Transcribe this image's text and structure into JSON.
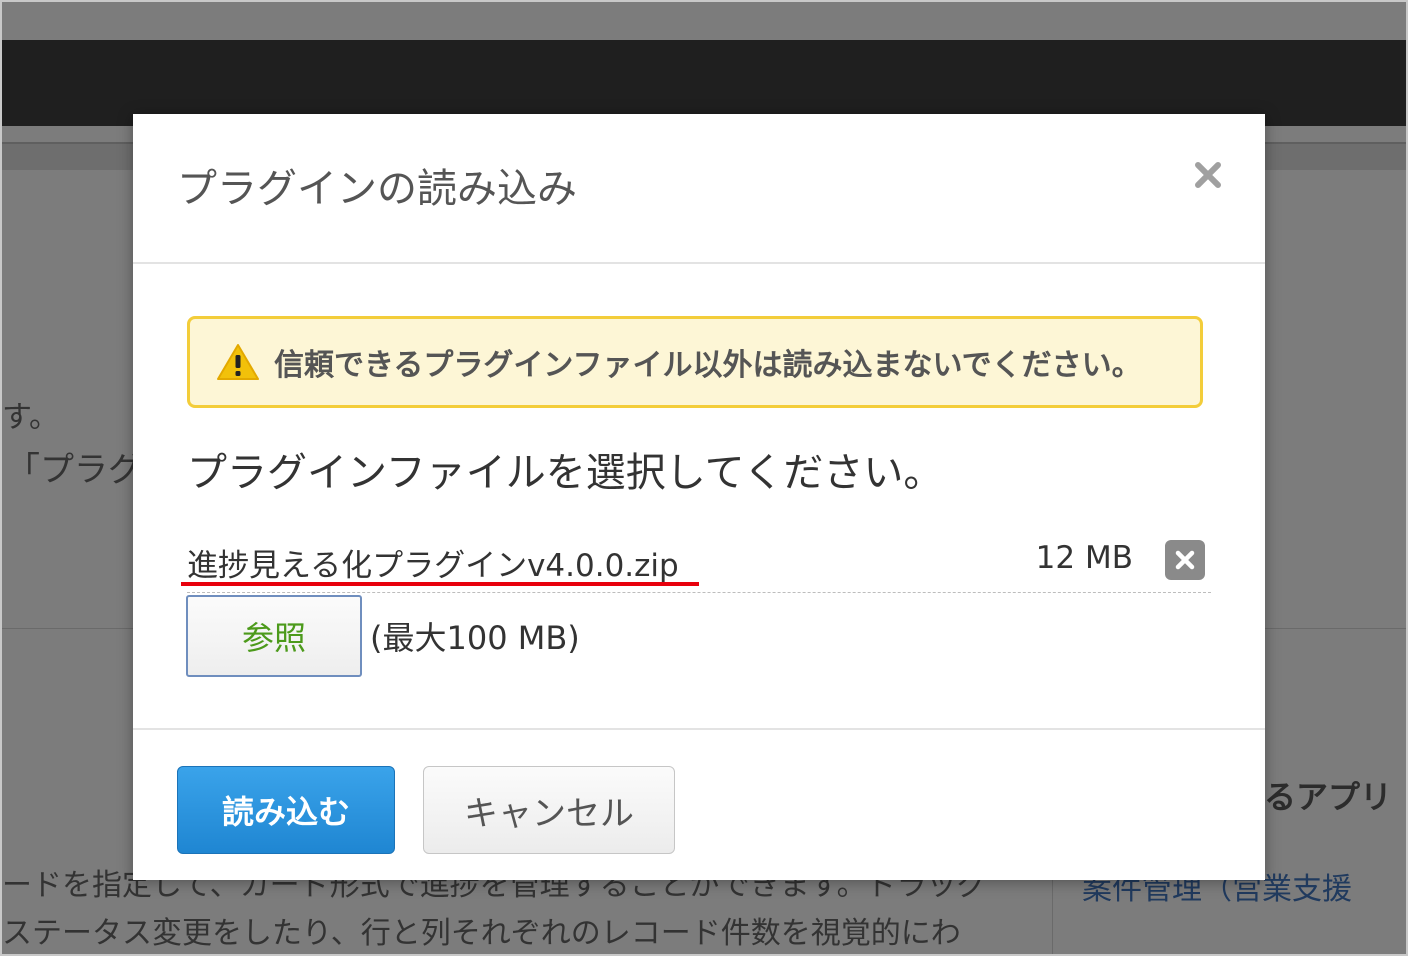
{
  "background": {
    "fragment_1": "す。",
    "fragment_2": "「プラグ",
    "apps_title": "るアプリ",
    "app_link": "案件管理（営業支援",
    "desc_line_1": "ードを指定して、カード形式で進捗を管理することができます。ドラッグ",
    "desc_line_2": "ステータス変更をしたり、行と列それぞれのレコード件数を視覚的にわ"
  },
  "dialog": {
    "title": "プラグインの読み込み",
    "close_icon": "close-icon",
    "warning": {
      "icon": "warning-icon",
      "text": "信頼できるプラグインファイル以外は読み込まないでください。"
    },
    "instruction": "プラグインファイルを選択してください。",
    "file": {
      "name": "進捗見える化プラグインv4.0.0.zip",
      "size": "12 MB",
      "remove_icon": "remove-file-icon"
    },
    "browse_label": "参照",
    "max_size": "(最大100 MB)",
    "import_label": "読み込む",
    "cancel_label": "キャンセル"
  },
  "colors": {
    "primary_button": "#1f86d2",
    "warning_border": "#f3cd3a",
    "warning_background": "#fdf6d6",
    "highlight_underline": "#e8000d",
    "browse_text": "#4c9a1b"
  }
}
